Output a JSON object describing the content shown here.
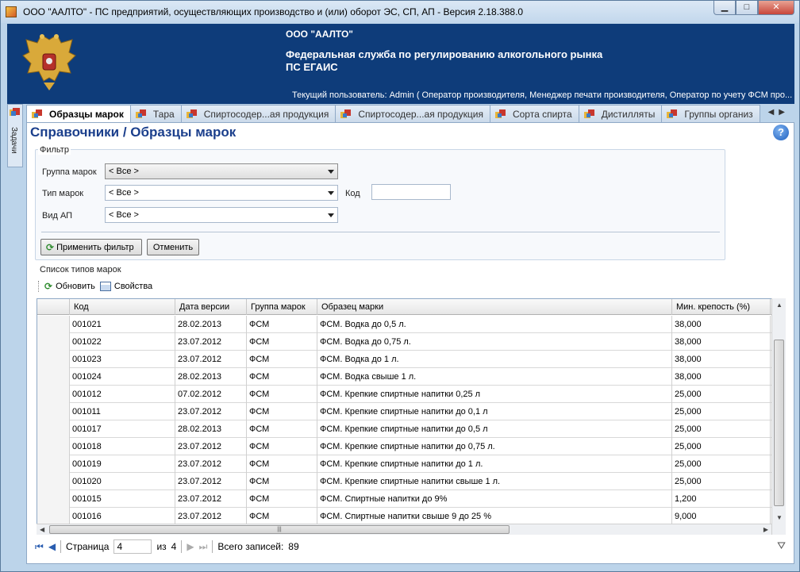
{
  "window": {
    "title": "ООО \"ААЛТО\" - ПС предприятий, осуществляющих производство и (или) оборот ЭС, СП, АП - Версия 2.18.388.0",
    "controls": {
      "minimize": "▁",
      "maximize": "□",
      "close": "✕"
    }
  },
  "header": {
    "org": "ООО \"ААЛТО\"",
    "agency_line1": "Федеральная служба по регулированию алкогольного рынка",
    "agency_line2": "ПС ЕГАИС",
    "user": "Текущий пользователь: Admin ( Оператор производителя, Менеджер печати производителя, Оператор по учету ФСМ про..."
  },
  "side_panel": {
    "label": "Задачи"
  },
  "tabs": [
    {
      "label": "Образцы марок",
      "active": true
    },
    {
      "label": "Тара",
      "active": false
    },
    {
      "label": "Спиртосодер...ая продукция",
      "active": false
    },
    {
      "label": "Спиртосодер...ая продукция",
      "active": false
    },
    {
      "label": "Сорта спирта",
      "active": false
    },
    {
      "label": "Дистилляты",
      "active": false
    },
    {
      "label": "Группы организ",
      "active": false
    }
  ],
  "page": {
    "title": "Справочники / Образцы марок",
    "help": "?"
  },
  "filter": {
    "legend": "Фильтр",
    "group_label": "Группа марок",
    "group_value": "< Все >",
    "type_label": "Тип марок",
    "type_value": "< Все >",
    "code_label": "Код",
    "code_value": "",
    "kind_label": "Вид АП",
    "kind_value": "< Все >",
    "apply_button": "Применить фильтр",
    "cancel_button": "Отменить"
  },
  "list": {
    "legend": "Список типов марок",
    "refresh_button": "Обновить",
    "properties_button": "Свойства",
    "columns": [
      "Код",
      "Дата версии",
      "Группа марок",
      "Образец марки",
      "Мин. крепость (%)"
    ],
    "rows": [
      [
        "001021",
        "28.02.2013",
        "ФСМ",
        "ФСМ. Водка до 0,5 л.",
        "38,000"
      ],
      [
        "001022",
        "23.07.2012",
        "ФСМ",
        "ФСМ. Водка до 0,75 л.",
        "38,000"
      ],
      [
        "001023",
        "23.07.2012",
        "ФСМ",
        "ФСМ. Водка до 1 л.",
        "38,000"
      ],
      [
        "001024",
        "28.02.2013",
        "ФСМ",
        "ФСМ. Водка свыше 1 л.",
        "38,000"
      ],
      [
        "001012",
        "07.02.2012",
        "ФСМ",
        "ФСМ. Крепкие спиртные напитки 0,25 л",
        "25,000"
      ],
      [
        "001011",
        "23.07.2012",
        "ФСМ",
        "ФСМ. Крепкие спиртные напитки до 0,1 л",
        "25,000"
      ],
      [
        "001017",
        "28.02.2013",
        "ФСМ",
        "ФСМ. Крепкие спиртные напитки до 0,5 л",
        "25,000"
      ],
      [
        "001018",
        "23.07.2012",
        "ФСМ",
        "ФСМ. Крепкие спиртные напитки до 0,75 л.",
        "25,000"
      ],
      [
        "001019",
        "23.07.2012",
        "ФСМ",
        "ФСМ. Крепкие спиртные напитки до 1 л.",
        "25,000"
      ],
      [
        "001020",
        "23.07.2012",
        "ФСМ",
        "ФСМ. Крепкие спиртные напитки свыше 1 л.",
        "25,000"
      ],
      [
        "001015",
        "23.07.2012",
        "ФСМ",
        "ФСМ. Спиртные напитки до 9%",
        "1,200"
      ],
      [
        "001016",
        "23.07.2012",
        "ФСМ",
        "ФСМ. Спиртные напитки свыше 9 до 25 %",
        "9,000"
      ]
    ]
  },
  "pager": {
    "page_label": "Страница",
    "page_value": "4",
    "of_label": "из",
    "total_pages": "4",
    "records_label": "Всего записей:",
    "records_value": "89"
  },
  "colors": {
    "header_bg": "#0e3c7a",
    "title_blue": "#1b3f8c",
    "frame": "#bcd4ea"
  }
}
